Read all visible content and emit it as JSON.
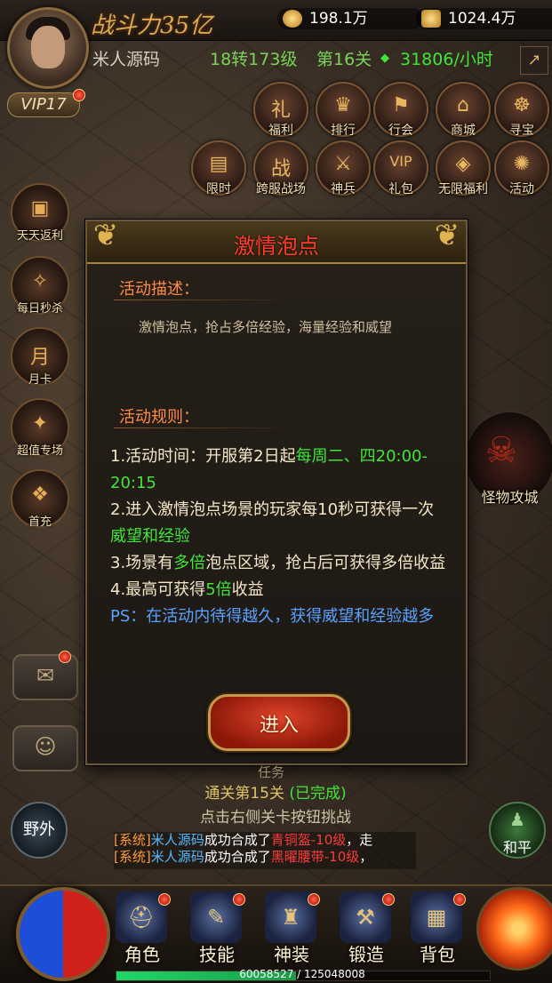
{
  "header": {
    "power_text": "战斗力35亿",
    "coins": "198.1万",
    "gold": "1024.4万",
    "vip": "VIP17",
    "player_name": "米人源码",
    "level": "18转173级",
    "stage": "第16关",
    "rate": "31806/小时"
  },
  "top_icons": [
    {
      "label": "福利",
      "icon": "gift-icon",
      "glyph": "礼"
    },
    {
      "label": "排行",
      "icon": "ranking-icon",
      "glyph": "♛"
    },
    {
      "label": "行会",
      "icon": "guild-icon",
      "glyph": "⚑"
    },
    {
      "label": "商城",
      "icon": "shop-icon",
      "glyph": "⌂"
    },
    {
      "label": "寻宝",
      "icon": "treasure-icon",
      "glyph": "☸"
    },
    {
      "label": "限时",
      "icon": "scroll-icon",
      "glyph": "▤"
    },
    {
      "label": "跨服战场",
      "icon": "battle-icon",
      "glyph": "战"
    },
    {
      "label": "神兵",
      "icon": "weapon-icon",
      "glyph": "⚔"
    },
    {
      "label": "礼包",
      "icon": "vip-icon",
      "glyph": "VIP"
    },
    {
      "label": "无限福利",
      "icon": "bag-icon",
      "glyph": "◈"
    },
    {
      "label": "活动",
      "icon": "event-icon",
      "glyph": "✺"
    }
  ],
  "left_icons": [
    {
      "label": "天天返利",
      "icon": "chest-icon",
      "glyph": "▣"
    },
    {
      "label": "每日秒杀",
      "icon": "flash-sale-icon",
      "glyph": "✧"
    },
    {
      "label": "月卡",
      "icon": "month-card-icon",
      "glyph": "月"
    },
    {
      "label": "超值专场",
      "icon": "special-icon",
      "glyph": "✦"
    },
    {
      "label": "首充",
      "icon": "first-charge-icon",
      "glyph": "❖"
    }
  ],
  "modal": {
    "title": "激情泡点",
    "desc_title": "活动描述：",
    "desc": "激情泡点，抢占多倍经验，海量经验和威望",
    "rules_title": "活动规则：",
    "rule1_a": "1.活动时间：开服第2日起",
    "rule1_b": "每周二、四20:00-20:15",
    "rule2_a": "2.进入激情泡点场景的玩家每10秒可获得一次",
    "rule2_b": "威望和经验",
    "rule3_a": "3.场景有",
    "rule3_b": "多倍",
    "rule3_c": "泡点区域，抢占后可获得多倍收益",
    "rule4_a": "4.最高可获得",
    "rule4_b": "5倍",
    "rule4_c": "收益",
    "ps": "PS：在活动内待得越久，获得威望和经验越多",
    "enter": "进入"
  },
  "right_boss": "怪物攻城",
  "quest": {
    "tab": "任务",
    "line1_a": "通关第15关",
    "line1_b": "(已完成)",
    "line2": "点击右侧关卡按钮挑战"
  },
  "chat": [
    {
      "sys": "[系统]",
      "name": "米人源码",
      "mid": "成功合成了",
      "item": "青铜盔-10级",
      "tail": "，走"
    },
    {
      "sys": "[系统]",
      "name": "米人源码",
      "mid": "成功合成了",
      "item": "黑曜腰带-10级",
      "tail": "，"
    }
  ],
  "left_round": "野外",
  "right_round": "和平",
  "bottom_nav": [
    {
      "label": "角色",
      "icon": "character-icon",
      "glyph": "⛑"
    },
    {
      "label": "技能",
      "icon": "skill-book-icon",
      "glyph": "✎"
    },
    {
      "label": "神装",
      "icon": "armor-icon",
      "glyph": "♜"
    },
    {
      "label": "锻造",
      "icon": "forge-icon",
      "glyph": "⚒"
    },
    {
      "label": "背包",
      "icon": "backpack-icon",
      "glyph": "▦"
    }
  ],
  "xp": {
    "text": "60058527 / 125048008",
    "fraction": 0.48
  },
  "colors": {
    "accent_green": "#41e53a",
    "title_red": "#ff3d2a",
    "ps_blue": "#5aa2ff",
    "section_orange": "#ff8a4a"
  }
}
